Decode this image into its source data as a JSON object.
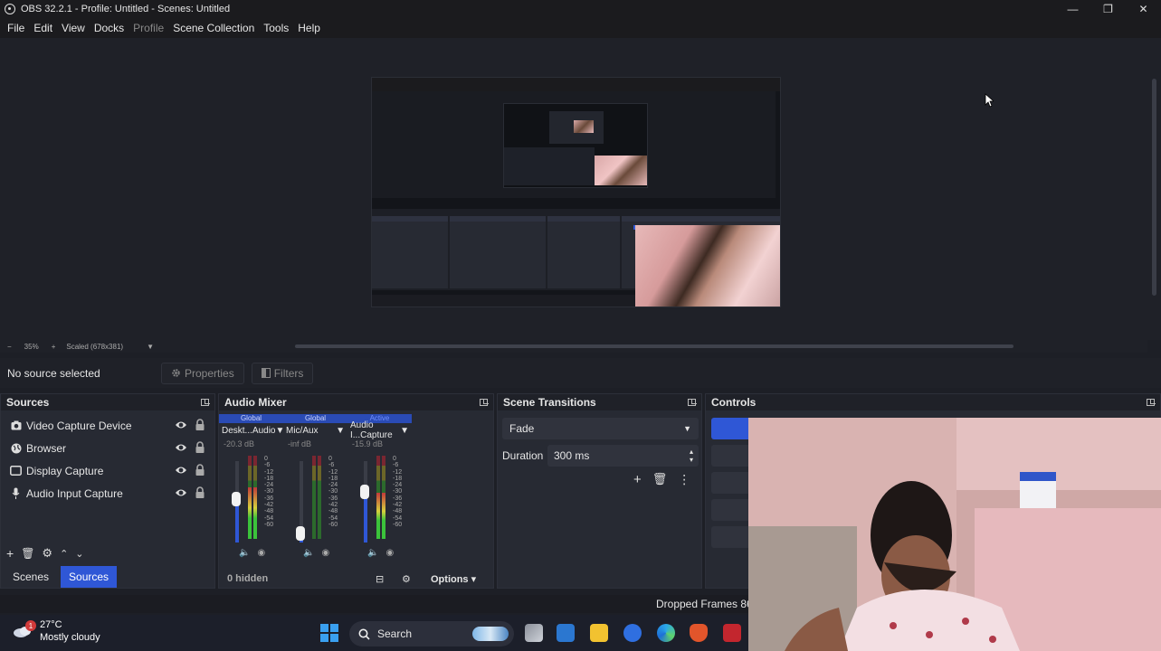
{
  "window": {
    "title": "OBS 32.2.1 - Profile: Untitled - Scenes: Untitled",
    "controls": {
      "minimize": "—",
      "restore": "❐",
      "close": "✕"
    }
  },
  "menu": [
    "File",
    "Edit",
    "View",
    "Docks",
    "Profile",
    "Scene Collection",
    "Tools",
    "Help"
  ],
  "preview": {
    "zoom_minus": "−",
    "zoom_level": "35%",
    "zoom_plus": "+",
    "scale_text": "Scaled (678x381)"
  },
  "source_bar": {
    "status": "No source selected",
    "properties_label": "Properties",
    "filters_label": "Filters"
  },
  "sources": {
    "title": "Sources",
    "items": [
      {
        "name": "Video Capture Device",
        "icon": "camera-icon"
      },
      {
        "name": "Browser",
        "icon": "globe-icon"
      },
      {
        "name": "Display Capture",
        "icon": "monitor-icon"
      },
      {
        "name": "Audio Input Capture",
        "icon": "microphone-icon"
      }
    ],
    "tabs": [
      "Scenes",
      "Sources"
    ],
    "active_tab": "Sources"
  },
  "audio_mixer": {
    "title": "Audio Mixer",
    "channels": [
      {
        "tag": "Global",
        "name": "Deskt...Audio",
        "db": "-20.3 dB",
        "level": 0.62
      },
      {
        "tag": "Global",
        "name": "Mic/Aux",
        "db": "-inf dB",
        "level": 0.0
      },
      {
        "tag": "Active",
        "name": "Audio I...Capture",
        "db": "-15.9 dB",
        "level": 0.55
      }
    ],
    "scale": [
      "0",
      "-6",
      "-12",
      "-18",
      "-24",
      "-30",
      "-36",
      "-42",
      "-48",
      "-54",
      "-60"
    ],
    "hidden_label": "0 hidden",
    "options_label": "Options"
  },
  "scene_transitions": {
    "title": "Scene Transitions",
    "transition": "Fade",
    "duration_label": "Duration",
    "duration_value": "300 ms"
  },
  "controls": {
    "title": "Controls"
  },
  "status_bar": {
    "dropped_frames": "Dropped Frames 86"
  },
  "taskbar": {
    "weather_temp": "27°C",
    "weather_desc": "Mostly cloudy",
    "notification_count": "1",
    "search_label": "Search"
  },
  "colors": {
    "accent": "#2f57d6",
    "panel": "#272a33",
    "background": "#1d1f26"
  }
}
